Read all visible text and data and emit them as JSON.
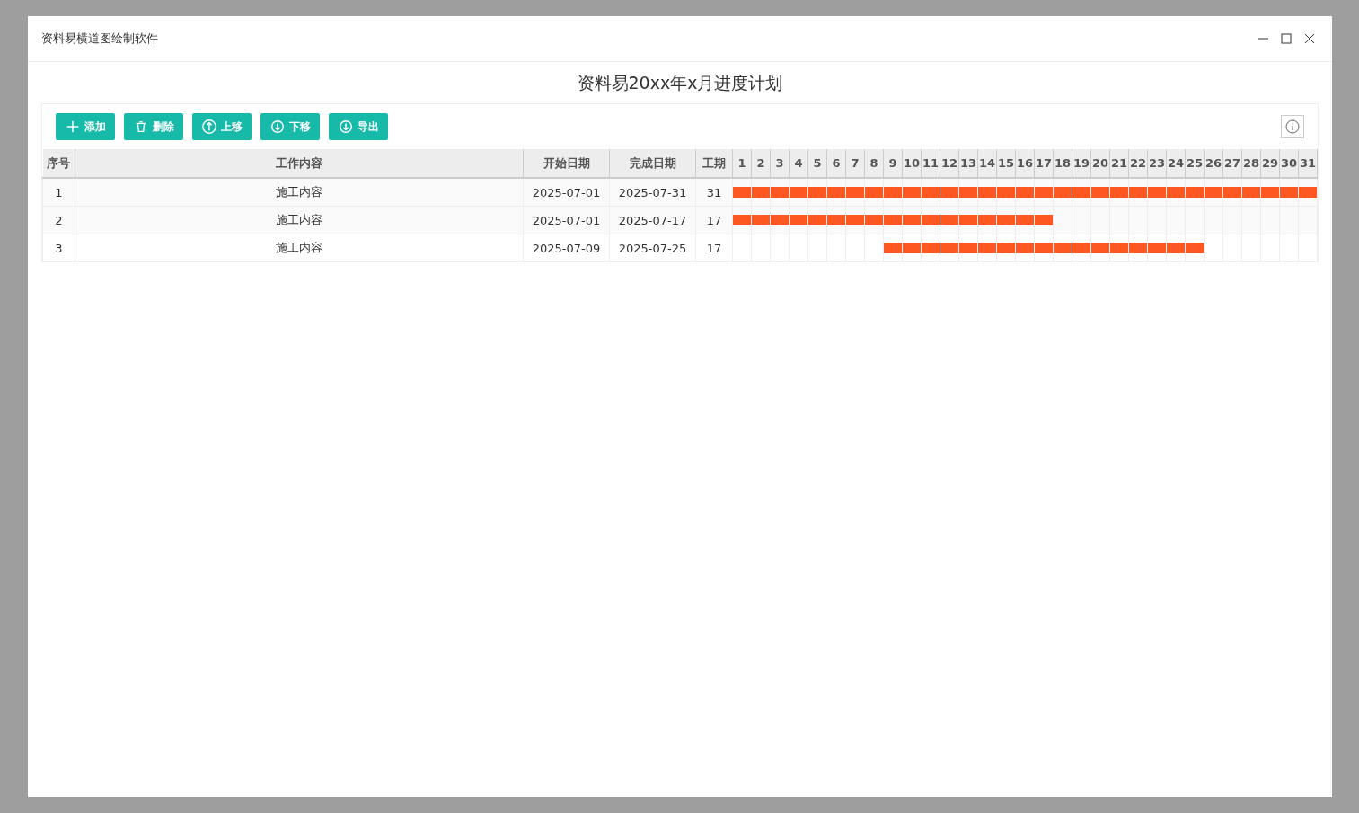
{
  "window": {
    "title": "资料易横道图绘制软件"
  },
  "heading": "资料易20xx年x月进度计划",
  "toolbar": [
    {
      "kind": "plus",
      "label": "添加"
    },
    {
      "kind": "trash",
      "label": "删除"
    },
    {
      "kind": "up",
      "label": "上移"
    },
    {
      "kind": "down",
      "label": "下移"
    },
    {
      "kind": "export",
      "label": "导出"
    }
  ],
  "table": {
    "columns": [
      "序号",
      "工作内容",
      "开始日期",
      "完成日期",
      "工期"
    ],
    "days": [
      "1",
      "2",
      "3",
      "4",
      "5",
      "6",
      "7",
      "8",
      "9",
      "10",
      "11",
      "12",
      "13",
      "14",
      "15",
      "16",
      "17",
      "18",
      "19",
      "20",
      "21",
      "22",
      "23",
      "24",
      "25",
      "26",
      "27",
      "28",
      "29",
      "30",
      "31"
    ],
    "rows": [
      {
        "index": "1",
        "content": "施工内容",
        "start": "2025-07-01",
        "end": "2025-07-31",
        "duration": "31",
        "filled_days": [
          true,
          true,
          true,
          true,
          true,
          true,
          true,
          true,
          true,
          true,
          true,
          true,
          true,
          true,
          true,
          true,
          true,
          true,
          true,
          true,
          true,
          true,
          true,
          true,
          true,
          true,
          true,
          true,
          true,
          true,
          true
        ]
      },
      {
        "index": "2",
        "content": "施工内容",
        "start": "2025-07-01",
        "end": "2025-07-17",
        "duration": "17",
        "filled_days": [
          true,
          true,
          true,
          true,
          true,
          true,
          true,
          true,
          true,
          true,
          true,
          true,
          true,
          true,
          true,
          true,
          true,
          false,
          false,
          false,
          false,
          false,
          false,
          false,
          false,
          false,
          false,
          false,
          false,
          false,
          false
        ]
      },
      {
        "index": "3",
        "content": "施工内容",
        "start": "2025-07-09",
        "end": "2025-07-25",
        "duration": "17",
        "filled_days": [
          false,
          false,
          false,
          false,
          false,
          false,
          false,
          false,
          true,
          true,
          true,
          true,
          true,
          true,
          true,
          true,
          true,
          true,
          true,
          true,
          true,
          true,
          true,
          true,
          true,
          false,
          false,
          false,
          false,
          false,
          false
        ]
      }
    ]
  }
}
